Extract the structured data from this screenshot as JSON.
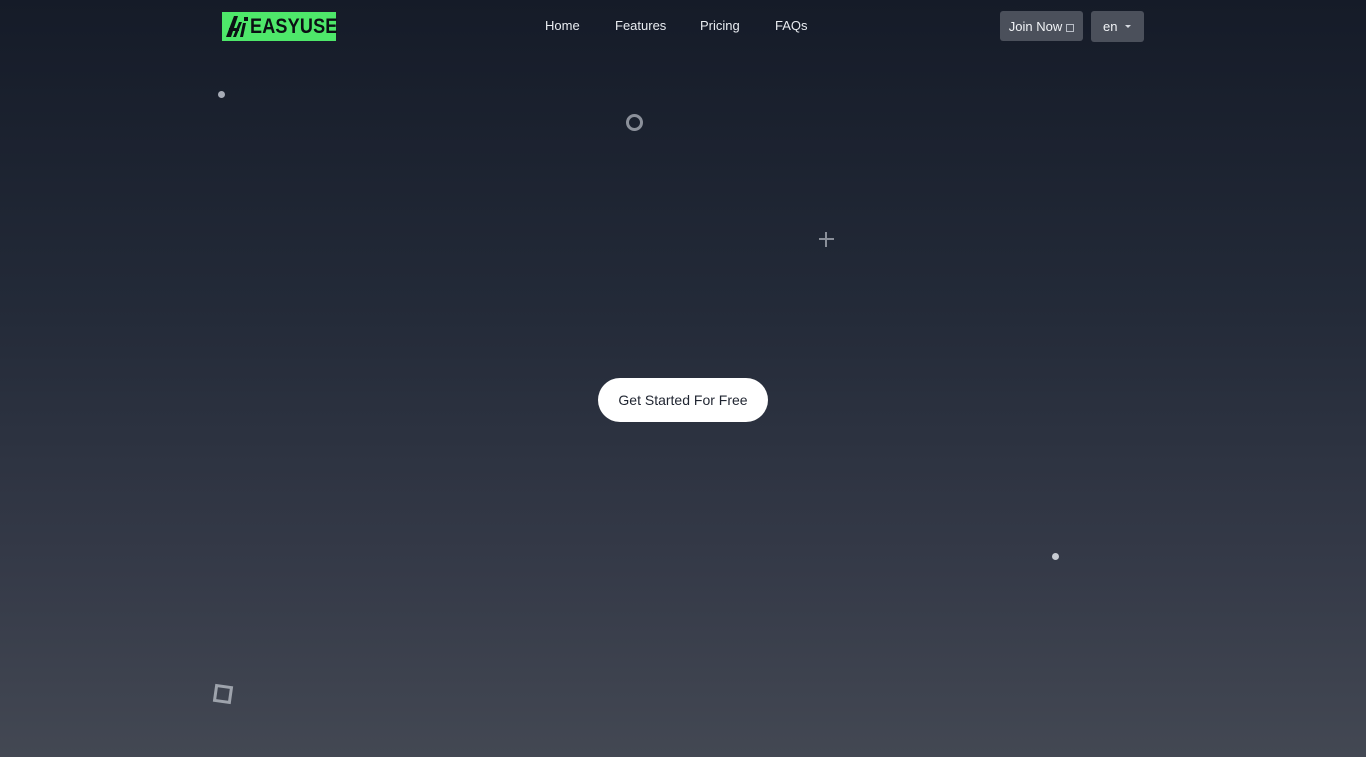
{
  "brand": {
    "logo_text": "EASYUSE",
    "logo_mark": "Ai",
    "logo_color": "#4ee76a"
  },
  "nav": {
    "links": [
      {
        "label": "Home"
      },
      {
        "label": "Features"
      },
      {
        "label": "Pricing"
      },
      {
        "label": "FAQs"
      }
    ],
    "join_label": "Join Now",
    "join_icon": "external-link-icon",
    "language": {
      "selected": "en",
      "icon": "chevron-down-icon"
    }
  },
  "hero": {
    "cta_label": "Get Started For Free"
  },
  "colors": {
    "background_top": "#151b28",
    "background_bottom": "#434853",
    "button_bg": "#4b505b",
    "cta_bg": "#ffffff"
  }
}
